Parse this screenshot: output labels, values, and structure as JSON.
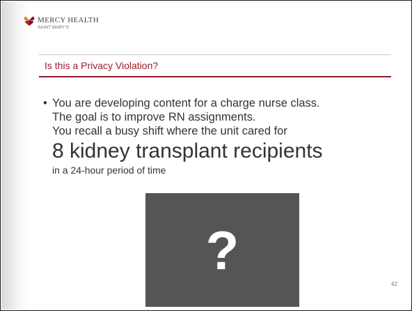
{
  "logo": {
    "name": "MERCY HEALTH",
    "sub": "SAINT MARY'S",
    "mark_colors": {
      "top": "#b0272e",
      "left": "#e08a20",
      "right": "#8a1b2a"
    }
  },
  "slide": {
    "title": "Is this a Privacy Violation?",
    "bullet": "•",
    "lines": [
      "You are developing content for a charge nurse class.",
      "The goal is to improve RN assignments.",
      "You recall a busy shift where the unit cared for"
    ],
    "emphasis": "8 kidney transplant recipients",
    "trailing": "in a 24-hour period of time",
    "placeholder_symbol": "?",
    "page_number": "42"
  },
  "colors": {
    "title": "#9b1c2c",
    "rule": "#8a1b2a",
    "body_text": "#333333",
    "placeholder_box": "#555555"
  }
}
